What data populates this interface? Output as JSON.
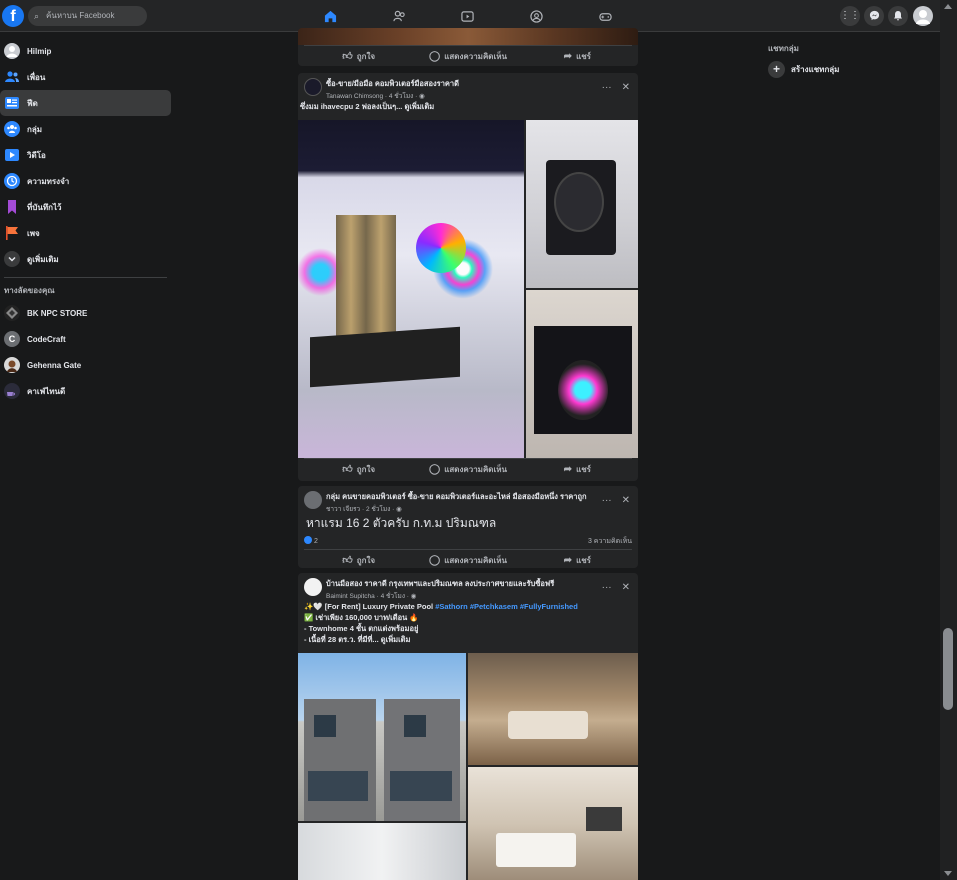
{
  "topbar": {
    "search_placeholder": "ค้นหาบน Facebook",
    "logo": "f",
    "nav_icons": [
      "home-icon",
      "friends-icon",
      "watch-icon",
      "groups-icon",
      "gaming-icon"
    ],
    "right_icons": [
      "menu-grid-icon",
      "messenger-icon",
      "notifications-icon",
      "account-avatar"
    ]
  },
  "sidebar": {
    "items": [
      {
        "label": "Hilmip",
        "icon": "profile-avatar"
      },
      {
        "label": "เพื่อน",
        "icon": "friends-icon"
      },
      {
        "label": "ฟีด",
        "icon": "feed-icon"
      },
      {
        "label": "กลุ่ม",
        "icon": "groups-icon"
      },
      {
        "label": "วิดีโอ",
        "icon": "video-icon"
      },
      {
        "label": "ความทรงจำ",
        "icon": "memories-icon"
      },
      {
        "label": "ที่บันทึกไว้",
        "icon": "saved-icon"
      },
      {
        "label": "เพจ",
        "icon": "pages-icon"
      },
      {
        "label": "ดูเพิ่มเติม",
        "icon": "chevron-down-icon"
      }
    ],
    "shortcuts_title": "ทางลัดของคุณ",
    "shortcuts": [
      {
        "label": "BK NPC STORE"
      },
      {
        "label": "CodeCraft",
        "initial": "C"
      },
      {
        "label": "Gehenna Gate"
      },
      {
        "label": "คาเฟ่ไทนดี"
      }
    ]
  },
  "right": {
    "group_chats_title": "แชทกลุ่ม",
    "create_group_label": "สร้างแชทกลุ่ม"
  },
  "actions": {
    "like": "ถูกใจ",
    "comment": "แสดงความคิดเห็น",
    "share": "แชร์"
  },
  "posts": [
    {
      "group": "ซื้อ-ขาย/มือมือ คอมพิวเตอร์มือสองราคาดี",
      "author": "Tanawan Chimsong",
      "time": "4 ชั่วโมง",
      "text": "ซึ่งมม ihavecpu 2 ฟอลงเป็นๆ...",
      "see_more": "ดูเพิ่มเติม"
    },
    {
      "group": "กลุ่ม คนขายคอมพิวเตอร์ ซื้อ-ขาย คอมพิวเตอร์และอะไหล่ มือสองมือหนึ่ง ราคาถูก",
      "author": "ชาวา เจียรว",
      "time": "2 ชั่วโมง",
      "text": "หาแรม 16 2 ตัวครับ ก.ท.ม ปริมณฑล",
      "reactions": "2",
      "comments": "3 ความคิดเห็น"
    },
    {
      "group": "บ้านมือสอง ราคาดี กรุงเทพฯและปริมณฑล ลงประกาศขายและรับซื้อฟรี",
      "author": "Baimint Supitcha",
      "time": "4 ชั่วโมง",
      "line1_prefix": "✨🤍 [For Rent] Luxury Private Pool",
      "hashtags": [
        "#Sathorn",
        "#Petchkasem",
        "#FullyFurnished"
      ],
      "line2": "✅ เช่าเพียง 160,000 บาท/เดือน 🔥",
      "line3": "- Townhome 4 ชั้น ตกแต่งพร้อมอยู่",
      "line4": "- เนื้อที่ 28 ตร.ว. ที่มีที่...",
      "see_more": "ดูเพิ่มเติม"
    }
  ],
  "colors": {
    "background": "#18191a",
    "surface": "#242526",
    "accent": "#2d88ff",
    "text": "#e4e6eb",
    "muted": "#b0b3b8"
  }
}
